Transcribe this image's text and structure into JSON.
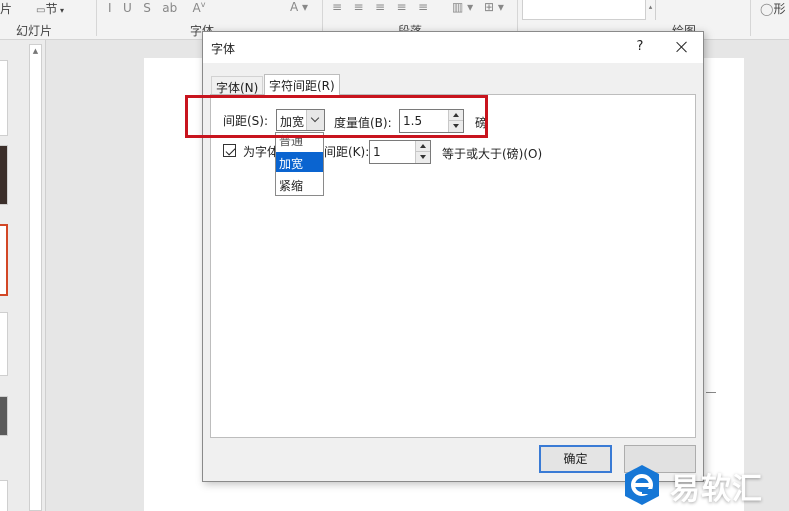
{
  "ribbon": {
    "left_text": "片",
    "section_label": "节",
    "groups": {
      "slides": "幻灯片",
      "font": "字体",
      "paragraph": "段落",
      "drawing": "绘图"
    },
    "right_text": "形"
  },
  "dialog": {
    "title": "字体",
    "help": "?",
    "tabs": [
      {
        "label": "字体(N)",
        "selected": false
      },
      {
        "label": "字符间距(R)",
        "selected": true
      }
    ],
    "spacing": {
      "label": "间距(S):",
      "value": "加宽",
      "options": [
        "普通",
        "加宽",
        "紧缩"
      ],
      "highlighted_option": "加宽"
    },
    "measure": {
      "label": "度量值(B):",
      "value": "1.5",
      "unit": "磅"
    },
    "kerning": {
      "checked": true,
      "label_left": "为字体",
      "label_right": "间距(K):",
      "value": "1",
      "suffix": "等于或大于(磅)(O)"
    },
    "buttons": {
      "ok": "确定",
      "cancel": ""
    }
  },
  "colors": {
    "highlight_border": "#c8141e",
    "selection_blue": "#0a64d0",
    "watermark_blue": "#1677d6"
  },
  "watermark": {
    "text": "易软汇"
  }
}
